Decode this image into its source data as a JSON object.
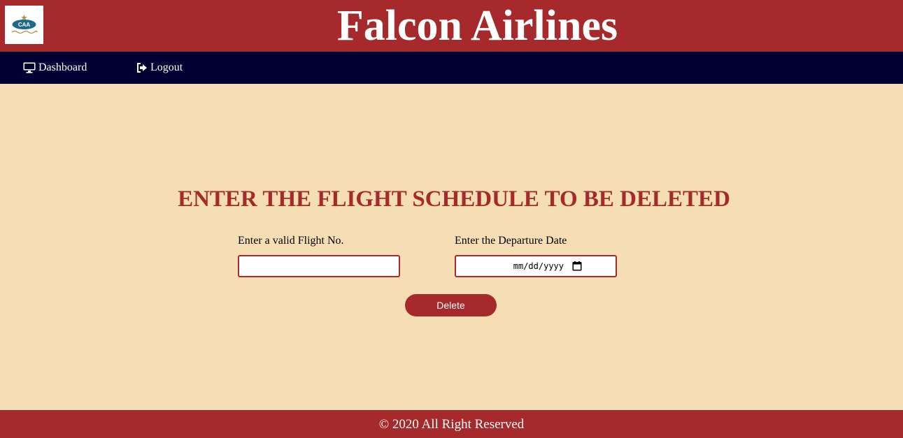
{
  "header": {
    "title": "Falcon Airlines",
    "logo_icon": "airline-logo-icon",
    "logo_text": "CAA"
  },
  "nav": {
    "items": [
      {
        "label": "Dashboard",
        "icon": "monitor-icon"
      },
      {
        "label": "Logout",
        "icon": "sign-out-icon"
      }
    ]
  },
  "main": {
    "heading": "ENTER THE FLIGHT SCHEDULE TO BE DELETED",
    "flight_label": "Enter a valid Flight No.",
    "flight_value": "",
    "date_label": "Enter the Departure Date",
    "date_placeholder": "mm/dd/yyyy",
    "date_icon": "calendar-icon",
    "delete_label": "Delete"
  },
  "footer": {
    "text": "© 2020 All Right Reserved"
  },
  "colors": {
    "brand": "#a6292b",
    "nav": "#000033",
    "background": "#f5deb3"
  }
}
